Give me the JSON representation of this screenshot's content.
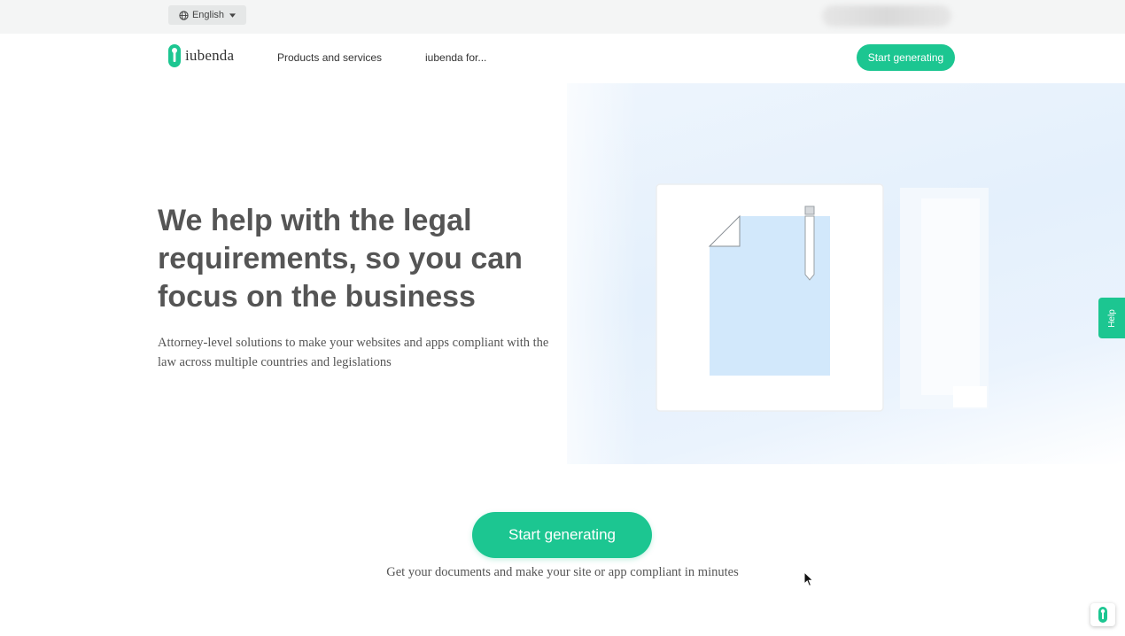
{
  "topbar": {
    "language_label": "English"
  },
  "nav": {
    "logo_text": "iubenda",
    "links": [
      {
        "label": "Products and services"
      },
      {
        "label": "iubenda for..."
      }
    ],
    "cta_label": "Start generating"
  },
  "hero": {
    "title": "We help with the legal requirements, so you can focus on the business",
    "subtitle": "Attorney-level solutions to make your websites and apps compliant with the law across multiple countries and legislations"
  },
  "cta": {
    "label": "Start generating",
    "caption": "Get your documents and make your site or app compliant in minutes"
  },
  "help": {
    "label": "Help"
  },
  "colors": {
    "brand_green": "#1cc691",
    "text_gray": "#555555",
    "document_blue": "#d2e8fb"
  },
  "icons": {
    "language": "globe-icon",
    "dropdown": "caret-down-icon",
    "logo": "keyhole-logo-icon",
    "badge": "keyhole-badge-icon",
    "pointer": "mouse-cursor-icon"
  }
}
